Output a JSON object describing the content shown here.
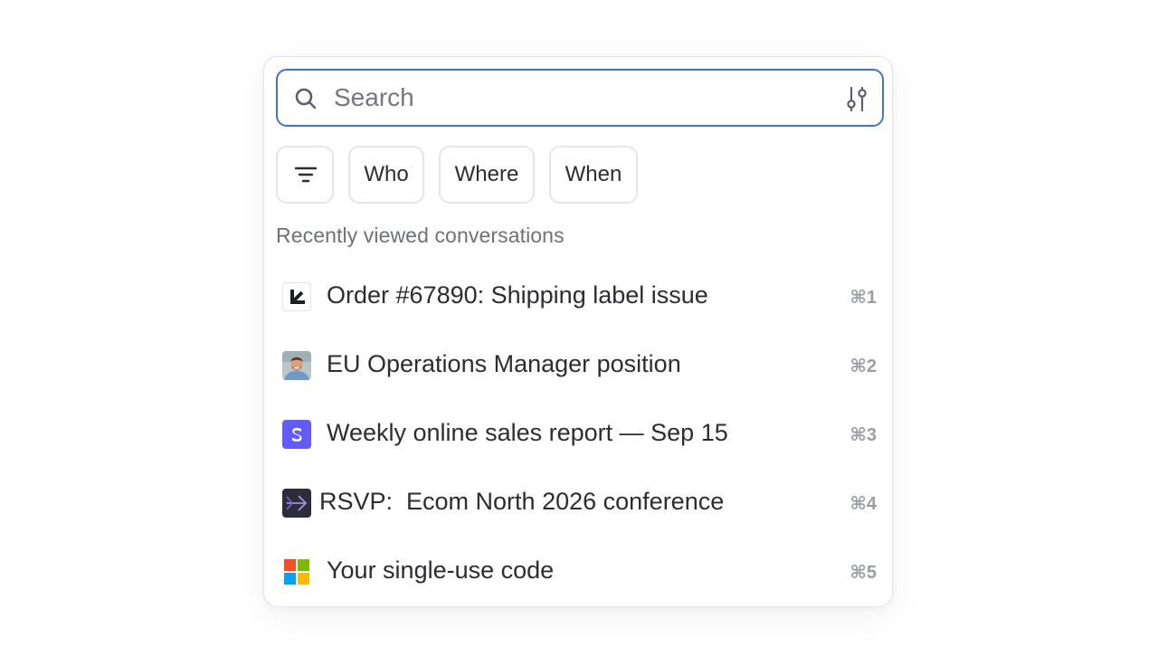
{
  "search": {
    "placeholder": "Search"
  },
  "filters": {
    "chips": [
      "Who",
      "Where",
      "When"
    ]
  },
  "section_title": "Recently viewed conversations",
  "conversations": [
    {
      "title": "Order #67890: Shipping label issue",
      "shortcut": "⌘1",
      "icon": "arrow-down-left-logo"
    },
    {
      "title": "EU Operations Manager position",
      "shortcut": "⌘2",
      "icon": "person-avatar"
    },
    {
      "title": "Weekly online sales report — Sep 15",
      "shortcut": "⌘3",
      "icon": "stripe-s-logo"
    },
    {
      "title": "RSVP:  Ecom North 2026 conference",
      "shortcut": "⌘4",
      "icon": "arrow-right-logo"
    },
    {
      "title": "Your single-use code",
      "shortcut": "⌘5",
      "icon": "microsoft-logo"
    }
  ],
  "colors": {
    "accent": "#3b73d9",
    "stripe": "#635bff",
    "ms_red": "#f25022",
    "ms_green": "#7fba00",
    "ms_blue": "#00a4ef",
    "ms_yellow": "#ffb900"
  }
}
